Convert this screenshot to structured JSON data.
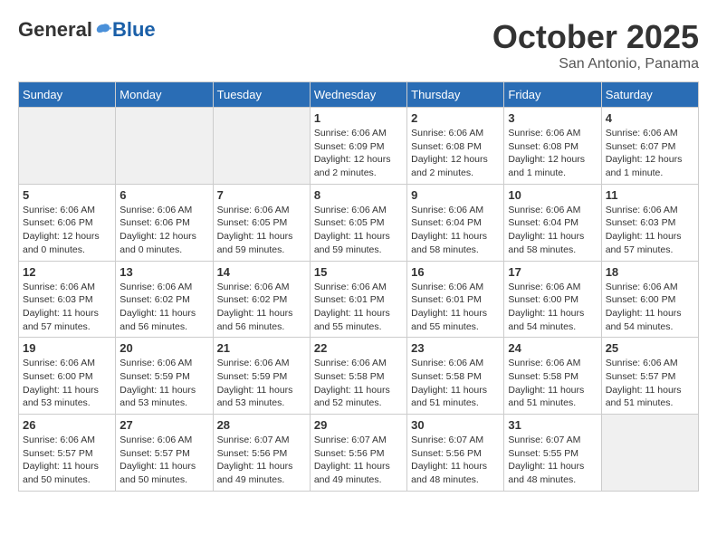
{
  "header": {
    "logo_general": "General",
    "logo_blue": "Blue",
    "title": "October 2025",
    "subtitle": "San Antonio, Panama"
  },
  "weekdays": [
    "Sunday",
    "Monday",
    "Tuesday",
    "Wednesday",
    "Thursday",
    "Friday",
    "Saturday"
  ],
  "weeks": [
    [
      {
        "day": "",
        "info": ""
      },
      {
        "day": "",
        "info": ""
      },
      {
        "day": "",
        "info": ""
      },
      {
        "day": "1",
        "info": "Sunrise: 6:06 AM\nSunset: 6:09 PM\nDaylight: 12 hours and 2 minutes."
      },
      {
        "day": "2",
        "info": "Sunrise: 6:06 AM\nSunset: 6:08 PM\nDaylight: 12 hours and 2 minutes."
      },
      {
        "day": "3",
        "info": "Sunrise: 6:06 AM\nSunset: 6:08 PM\nDaylight: 12 hours and 1 minute."
      },
      {
        "day": "4",
        "info": "Sunrise: 6:06 AM\nSunset: 6:07 PM\nDaylight: 12 hours and 1 minute."
      }
    ],
    [
      {
        "day": "5",
        "info": "Sunrise: 6:06 AM\nSunset: 6:06 PM\nDaylight: 12 hours and 0 minutes."
      },
      {
        "day": "6",
        "info": "Sunrise: 6:06 AM\nSunset: 6:06 PM\nDaylight: 12 hours and 0 minutes."
      },
      {
        "day": "7",
        "info": "Sunrise: 6:06 AM\nSunset: 6:05 PM\nDaylight: 11 hours and 59 minutes."
      },
      {
        "day": "8",
        "info": "Sunrise: 6:06 AM\nSunset: 6:05 PM\nDaylight: 11 hours and 59 minutes."
      },
      {
        "day": "9",
        "info": "Sunrise: 6:06 AM\nSunset: 6:04 PM\nDaylight: 11 hours and 58 minutes."
      },
      {
        "day": "10",
        "info": "Sunrise: 6:06 AM\nSunset: 6:04 PM\nDaylight: 11 hours and 58 minutes."
      },
      {
        "day": "11",
        "info": "Sunrise: 6:06 AM\nSunset: 6:03 PM\nDaylight: 11 hours and 57 minutes."
      }
    ],
    [
      {
        "day": "12",
        "info": "Sunrise: 6:06 AM\nSunset: 6:03 PM\nDaylight: 11 hours and 57 minutes."
      },
      {
        "day": "13",
        "info": "Sunrise: 6:06 AM\nSunset: 6:02 PM\nDaylight: 11 hours and 56 minutes."
      },
      {
        "day": "14",
        "info": "Sunrise: 6:06 AM\nSunset: 6:02 PM\nDaylight: 11 hours and 56 minutes."
      },
      {
        "day": "15",
        "info": "Sunrise: 6:06 AM\nSunset: 6:01 PM\nDaylight: 11 hours and 55 minutes."
      },
      {
        "day": "16",
        "info": "Sunrise: 6:06 AM\nSunset: 6:01 PM\nDaylight: 11 hours and 55 minutes."
      },
      {
        "day": "17",
        "info": "Sunrise: 6:06 AM\nSunset: 6:00 PM\nDaylight: 11 hours and 54 minutes."
      },
      {
        "day": "18",
        "info": "Sunrise: 6:06 AM\nSunset: 6:00 PM\nDaylight: 11 hours and 54 minutes."
      }
    ],
    [
      {
        "day": "19",
        "info": "Sunrise: 6:06 AM\nSunset: 6:00 PM\nDaylight: 11 hours and 53 minutes."
      },
      {
        "day": "20",
        "info": "Sunrise: 6:06 AM\nSunset: 5:59 PM\nDaylight: 11 hours and 53 minutes."
      },
      {
        "day": "21",
        "info": "Sunrise: 6:06 AM\nSunset: 5:59 PM\nDaylight: 11 hours and 53 minutes."
      },
      {
        "day": "22",
        "info": "Sunrise: 6:06 AM\nSunset: 5:58 PM\nDaylight: 11 hours and 52 minutes."
      },
      {
        "day": "23",
        "info": "Sunrise: 6:06 AM\nSunset: 5:58 PM\nDaylight: 11 hours and 51 minutes."
      },
      {
        "day": "24",
        "info": "Sunrise: 6:06 AM\nSunset: 5:58 PM\nDaylight: 11 hours and 51 minutes."
      },
      {
        "day": "25",
        "info": "Sunrise: 6:06 AM\nSunset: 5:57 PM\nDaylight: 11 hours and 51 minutes."
      }
    ],
    [
      {
        "day": "26",
        "info": "Sunrise: 6:06 AM\nSunset: 5:57 PM\nDaylight: 11 hours and 50 minutes."
      },
      {
        "day": "27",
        "info": "Sunrise: 6:06 AM\nSunset: 5:57 PM\nDaylight: 11 hours and 50 minutes."
      },
      {
        "day": "28",
        "info": "Sunrise: 6:07 AM\nSunset: 5:56 PM\nDaylight: 11 hours and 49 minutes."
      },
      {
        "day": "29",
        "info": "Sunrise: 6:07 AM\nSunset: 5:56 PM\nDaylight: 11 hours and 49 minutes."
      },
      {
        "day": "30",
        "info": "Sunrise: 6:07 AM\nSunset: 5:56 PM\nDaylight: 11 hours and 48 minutes."
      },
      {
        "day": "31",
        "info": "Sunrise: 6:07 AM\nSunset: 5:55 PM\nDaylight: 11 hours and 48 minutes."
      },
      {
        "day": "",
        "info": ""
      }
    ]
  ]
}
